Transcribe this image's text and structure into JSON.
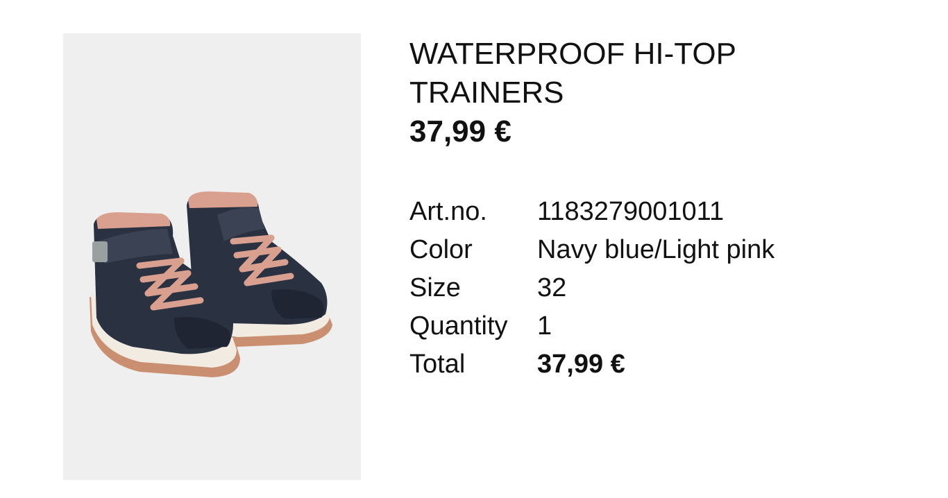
{
  "product": {
    "image_alt": "Navy blue hi-top trainers with light pink laces",
    "name": "WATERPROOF HI-TOP TRAINERS",
    "price": "37,99 €"
  },
  "details": [
    {
      "label": "Art.no.",
      "value": "1183279001011"
    },
    {
      "label": "Color",
      "value": "Navy blue/Light pink"
    },
    {
      "label": "Size",
      "value": "32"
    },
    {
      "label": "Quantity",
      "value": "1"
    },
    {
      "label": "Total",
      "value": "37,99 €"
    }
  ],
  "colors": {
    "image_bg": "#efefef",
    "shoe_navy": "#2a3140",
    "lace_pink": "#d9a08f",
    "sole_cream": "#f1ebe1",
    "sole_tan": "#c98f70"
  }
}
